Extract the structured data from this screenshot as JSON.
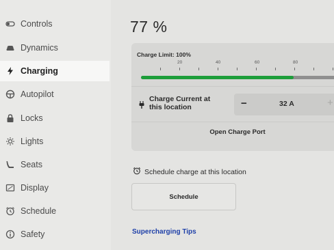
{
  "sidebar": {
    "items": [
      {
        "label": "Controls",
        "icon": "toggle-icon",
        "active": false
      },
      {
        "label": "Dynamics",
        "icon": "car-icon",
        "active": false
      },
      {
        "label": "Charging",
        "icon": "bolt-icon",
        "active": true
      },
      {
        "label": "Autopilot",
        "icon": "steering-wheel-icon",
        "active": false
      },
      {
        "label": "Locks",
        "icon": "lock-icon",
        "active": false
      },
      {
        "label": "Lights",
        "icon": "sun-icon",
        "active": false
      },
      {
        "label": "Seats",
        "icon": "seat-icon",
        "active": false
      },
      {
        "label": "Display",
        "icon": "display-icon",
        "active": false
      },
      {
        "label": "Schedule",
        "icon": "alarm-clock-icon",
        "active": false
      },
      {
        "label": "Safety",
        "icon": "info-circle-icon",
        "active": false
      }
    ]
  },
  "charging": {
    "battery_percent": "77 %",
    "charge_limit_label": "Charge Limit: 100%",
    "charge_limit_value": 100,
    "scale_labels": [
      "20",
      "40",
      "60",
      "80"
    ],
    "charge_current_label": "Charge Current at this location",
    "charge_current_value": "32 A",
    "minus_label": "−",
    "plus_label": "+",
    "open_charge_port_label": "Open Charge Port",
    "schedule_row_label": "Schedule charge at this location",
    "schedule_button_label": "Schedule",
    "supercharging_tips_label": "Supercharging Tips"
  },
  "colors": {
    "fill_green": "#1d9e3a",
    "link_blue": "#1d3fa8"
  }
}
